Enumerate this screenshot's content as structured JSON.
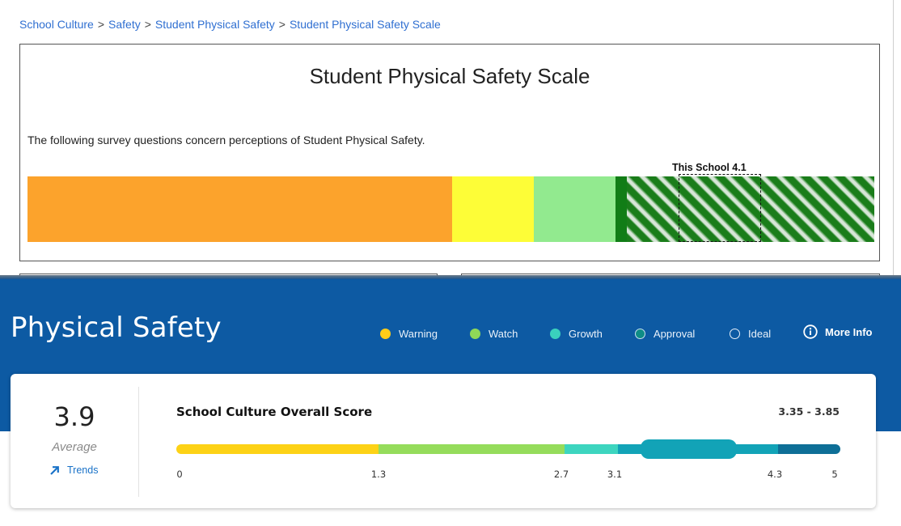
{
  "breadcrumb": {
    "items": [
      "School Culture",
      "Safety",
      "Student Physical Safety",
      "Student Physical Safety Scale"
    ],
    "separator": ">"
  },
  "scale_card": {
    "title": "Student Physical Safety Scale",
    "description": "The following survey questions concern perceptions of Student Physical Safety.",
    "marker_label": "This School 4.1",
    "colors": [
      "#fca32c",
      "#fdfd37",
      "#92ea8f",
      "#117d16"
    ]
  },
  "dashboard": {
    "title": "Physical Safety",
    "legend": [
      {
        "label": "Warning",
        "color": "#ffcc17"
      },
      {
        "label": "Watch",
        "color": "#8fd858"
      },
      {
        "label": "Growth",
        "color": "#3ad1bd"
      },
      {
        "label": "Approval",
        "color": "#0e8c86"
      },
      {
        "label": "Ideal",
        "color": "transparent"
      }
    ],
    "more_info_label": "More Info",
    "average": {
      "value": "3.9",
      "label": "Average",
      "trends_label": "Trends"
    },
    "score": {
      "title": "School Culture Overall Score",
      "range_label": "3.35 - 3.85",
      "ticks": [
        "0",
        "1.3",
        "2.7",
        "3.1",
        "4.3",
        "5"
      ]
    }
  }
}
